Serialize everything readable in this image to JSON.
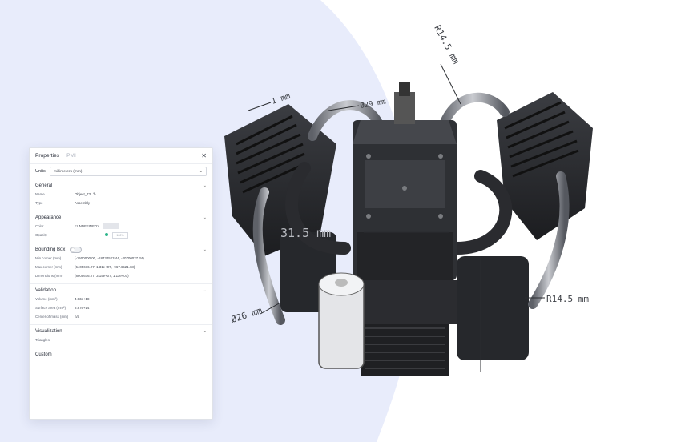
{
  "panel": {
    "tabs": [
      {
        "label": "Properties",
        "active": true
      },
      {
        "label": "PMI",
        "active": false
      }
    ],
    "close_icon": "close-icon",
    "units": {
      "label": "Units",
      "value": "millimeters (mm)"
    },
    "sections": {
      "general": {
        "title": "General",
        "name_label": "Name",
        "name_value": "Object_73",
        "type_label": "Type",
        "type_value": "Assembly"
      },
      "appearance": {
        "title": "Appearance",
        "color_label": "Color",
        "color_value": "<UNDEFINED>",
        "opacity_label": "Opacity",
        "opacity_level": 0.95,
        "opacity_value": "100%"
      },
      "bounding_box": {
        "title": "Bounding Box",
        "min_label": "Min corner (mm)",
        "min_value": "(-1500000.00, -18434523.44, -20700027.34)",
        "max_label": "Max corner (mm)",
        "max_value": "(5405676.27, 1.31e+07, -967.6521.68)",
        "dim_label": "Dimensions (mm)",
        "dim_value": "(8905676.27, 3.15e+07, 1.11e+07)"
      },
      "validation": {
        "title": "Validation",
        "volume_label": "Volume (mm³)",
        "volume_value": "4.93e+18",
        "surface_label": "Surface area (mm²)",
        "surface_value": "8.87e+14",
        "center_label": "Center of mass (mm)",
        "center_value": "n/a"
      },
      "visualization": {
        "title": "Visualization",
        "triangles_label": "Triangles"
      },
      "custom": {
        "title": "Custom"
      }
    }
  },
  "viewport": {
    "dimensions": [
      {
        "text": "R14.5 mm"
      },
      {
        "text": "1 mm"
      },
      {
        "text": "Ø29 mm"
      },
      {
        "text": "31.5 mm"
      },
      {
        "text": "R14.5 mm"
      },
      {
        "text": "Ø26 mm"
      }
    ]
  },
  "colors": {
    "background_blob": "#e8ecfb",
    "accent": "#2db58b"
  }
}
